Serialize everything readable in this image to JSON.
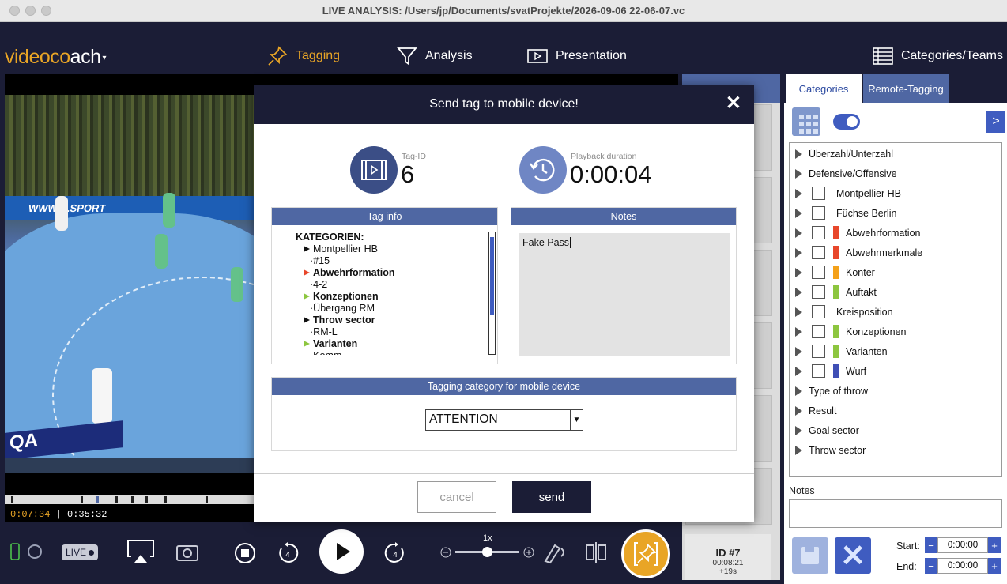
{
  "window": {
    "title": "LIVE ANALYSIS: /Users/jp/Documents/svatProjekte/2026-09-06 22-06-07.vc"
  },
  "app": {
    "logo_main": "videoco",
    "logo_rest": "ach",
    "logo_caret": "▾"
  },
  "nav": {
    "tagging": "Tagging",
    "analysis": "Analysis",
    "presentation": "Presentation",
    "categories_teams": "Categories/Teams"
  },
  "video": {
    "board_text": "WWW.N.SPORT",
    "ad_text": "QA",
    "current_time": "0:07:34",
    "total_time": "0:35:32"
  },
  "playback": {
    "live_label": "LIVE",
    "speed_label": "1x",
    "rewind_seconds": "4",
    "forward_seconds": "4"
  },
  "tag_card": {
    "id": "ID #7",
    "time": "00:08:21",
    "offset": "+19s"
  },
  "right_panel": {
    "tabs": [
      "Categories",
      "Remote-Tagging"
    ],
    "expand_label": ">",
    "categories": [
      {
        "label": "Überzahl/Unterzahl",
        "checkbox": false,
        "color": ""
      },
      {
        "label": "Defensive/Offensive",
        "checkbox": false,
        "color": ""
      },
      {
        "label": "Montpellier HB",
        "checkbox": true,
        "color": ""
      },
      {
        "label": "Füchse Berlin",
        "checkbox": true,
        "color": ""
      },
      {
        "label": "Abwehrformation",
        "checkbox": true,
        "color": "#e8472b"
      },
      {
        "label": "Abwehrmerkmale",
        "checkbox": true,
        "color": "#e8472b"
      },
      {
        "label": "Konter",
        "checkbox": true,
        "color": "#f4a11a"
      },
      {
        "label": "Auftakt",
        "checkbox": true,
        "color": "#8dc63f"
      },
      {
        "label": "Kreisposition",
        "checkbox": true,
        "color": ""
      },
      {
        "label": "Konzeptionen",
        "checkbox": true,
        "color": "#8dc63f"
      },
      {
        "label": "Varianten",
        "checkbox": true,
        "color": "#8dc63f"
      },
      {
        "label": "Wurf",
        "checkbox": true,
        "color": "#3f4fb5"
      },
      {
        "label": "Type of throw",
        "checkbox": false,
        "color": ""
      },
      {
        "label": "Result",
        "checkbox": false,
        "color": ""
      },
      {
        "label": "Goal sector",
        "checkbox": false,
        "color": ""
      },
      {
        "label": "Throw sector",
        "checkbox": false,
        "color": ""
      }
    ],
    "notes_label": "Notes",
    "start_label": "Start:",
    "end_label": "End:",
    "start_value": "0:00:00",
    "end_value": "0:00:00",
    "minus": "−",
    "plus": "+"
  },
  "dialog": {
    "title": "Send tag to mobile device!",
    "close": "✕",
    "tag_id_label": "Tag-ID",
    "tag_id_value": "6",
    "playback_label": "Playback duration",
    "playback_value": "0:00:04",
    "tag_info_header": "Tag info",
    "notes_header": "Notes",
    "notes_value": "Fake Pass",
    "tag_info": {
      "heading": "KATEGORIEN:",
      "lines": [
        {
          "text": "Montpellier HB",
          "bold": false,
          "arrow": "#111111",
          "indent": 1
        },
        {
          "text": "·#15",
          "bold": false,
          "arrow": "",
          "indent": 2
        },
        {
          "text": "Abwehrformation",
          "bold": true,
          "arrow": "#e8472b",
          "indent": 1
        },
        {
          "text": "·4-2",
          "bold": false,
          "arrow": "",
          "indent": 2
        },
        {
          "text": "Konzeptionen",
          "bold": true,
          "arrow": "#8dc63f",
          "indent": 1
        },
        {
          "text": "·Übergang RM",
          "bold": false,
          "arrow": "",
          "indent": 2
        },
        {
          "text": "Throw sector",
          "bold": true,
          "arrow": "#111111",
          "indent": 1
        },
        {
          "text": "·RM-L",
          "bold": false,
          "arrow": "",
          "indent": 2
        },
        {
          "text": "Varianten",
          "bold": true,
          "arrow": "#8dc63f",
          "indent": 1
        },
        {
          "text": "·Komm",
          "bold": false,
          "arrow": "",
          "indent": 2
        }
      ]
    },
    "mobile_header": "Tagging category for mobile device",
    "mobile_category": "ATTENTION",
    "dropdown_glyph": "▼",
    "cancel_label": "cancel",
    "send_label": "send"
  },
  "colors": {
    "accent_orange": "#e9a526",
    "brand_navy": "#1b1d36",
    "header_blue": "#4f67a3",
    "button_blue": "#3f5cc0"
  }
}
